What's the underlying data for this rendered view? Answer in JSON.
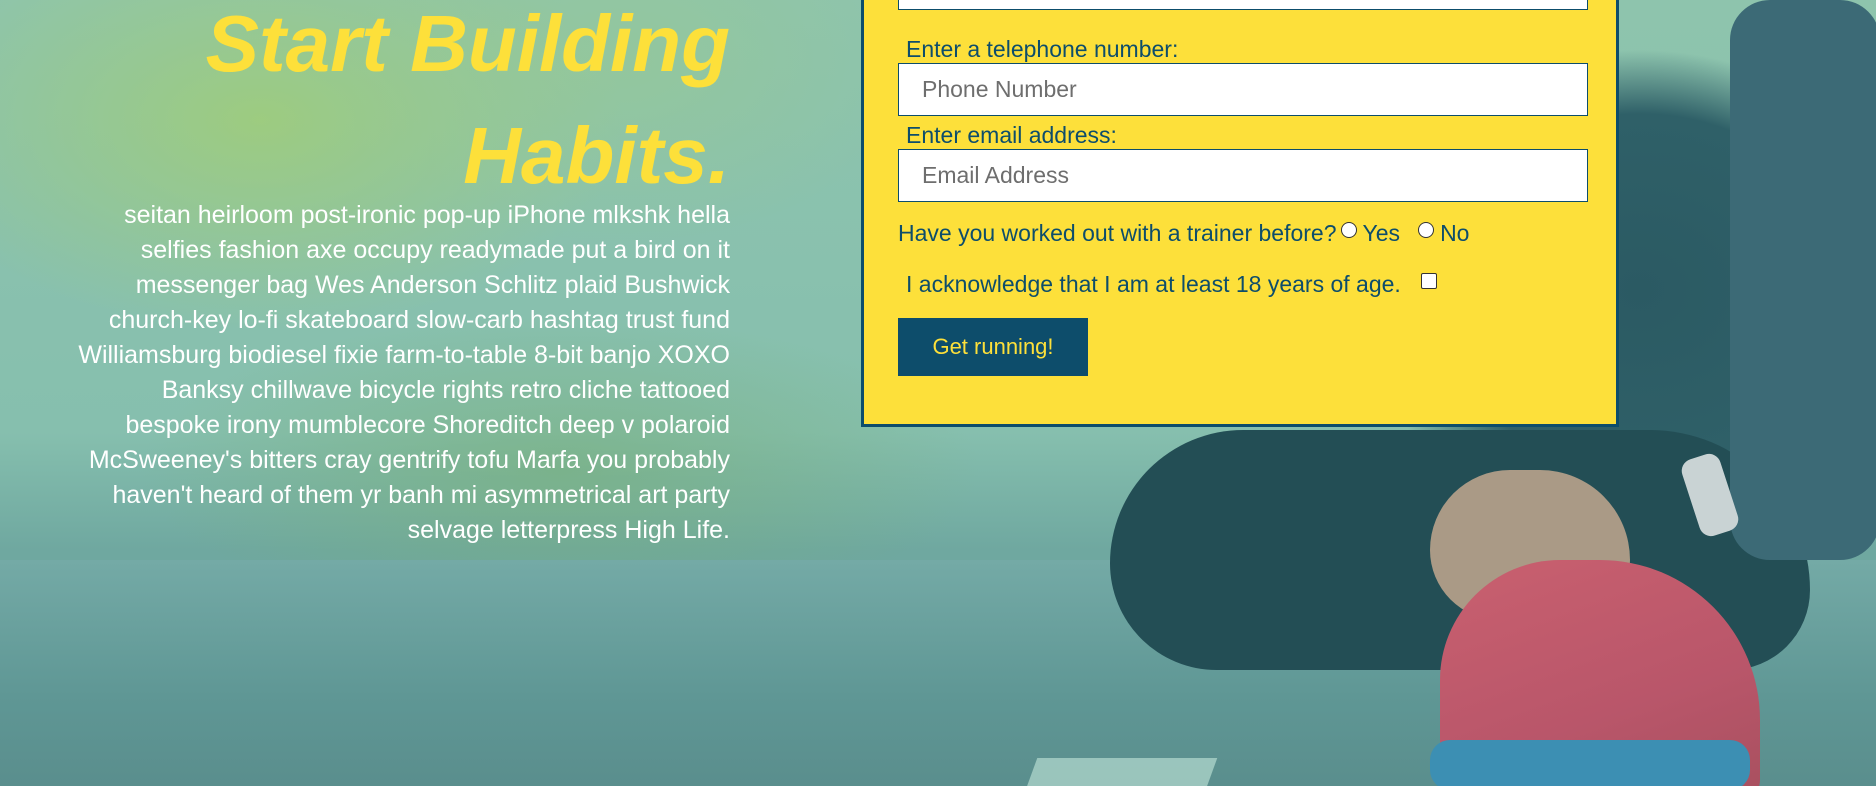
{
  "hero": {
    "title_line1": "Start Building",
    "title_line2": "Habits.",
    "intro": "seitan heirloom post-ironic pop-up iPhone mlkshk hella selfies fashion axe occupy readymade put a bird on it messenger bag Wes Anderson Schlitz plaid Bushwick church-key lo-fi skateboard slow-carb hashtag trust fund Williamsburg biodiesel fixie farm-to-table 8-bit banjo XOXO Banksy chillwave bicycle rights retro cliche tattooed bespoke irony mumblecore Shoreditch deep v polaroid McSweeney's bitters cray gentrify tofu Marfa you probably haven't heard of them yr banh mi asymmetrical art party selvage letterpress High Life."
  },
  "form": {
    "phone_label": "Enter a telephone number:",
    "phone_placeholder": "Phone Number",
    "email_label": "Enter email address:",
    "email_placeholder": "Email Address",
    "trainer_question": "Have you worked out with a trainer before?",
    "trainer_yes": "Yes",
    "trainer_no": "No",
    "age_ack": "I acknowledge that I am at least 18 years of age.",
    "submit_label": "Get running!"
  },
  "colors": {
    "accent_yellow": "#fde03a",
    "navy": "#0d4d6b",
    "overlay_teal": "#7fb8a9"
  },
  "icons": {
    "radio": "radio-button-icon",
    "checkbox": "checkbox-icon"
  }
}
